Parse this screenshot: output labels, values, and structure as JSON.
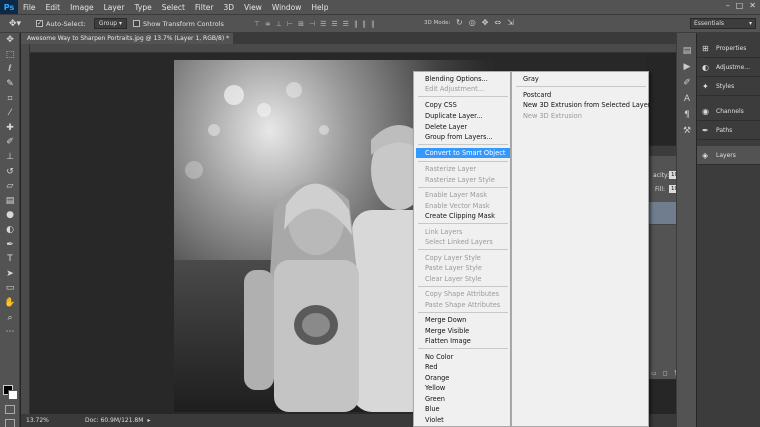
{
  "app": {
    "logo": "Ps"
  },
  "menubar": {
    "items": [
      "File",
      "Edit",
      "Image",
      "Layer",
      "Type",
      "Select",
      "Filter",
      "3D",
      "View",
      "Window",
      "Help"
    ],
    "window_controls": [
      "–",
      "□",
      "✕"
    ]
  },
  "options_bar": {
    "auto_select_label": "Auto-Select:",
    "auto_select_checked": true,
    "auto_select_target": "Group",
    "show_transform_label": "Show Transform Controls",
    "show_transform_checked": false,
    "mode_3d_label": "3D Mode:",
    "workspace": "Essentials"
  },
  "document": {
    "tab_title": "Awesome Way to Sharpen Portraits.jpg @ 13.7% (Layer 1, RGB/8) *",
    "zoom": "13.72%",
    "doc_info": "Doc: 60.9M/121.8M"
  },
  "right_panels": {
    "items": [
      {
        "label": "Properties",
        "icon": "properties-icon"
      },
      {
        "label": "Adjustme...",
        "icon": "adjustments-icon"
      },
      {
        "label": "Styles",
        "icon": "styles-icon"
      },
      {
        "label": "Channels",
        "icon": "channels-icon"
      },
      {
        "label": "Paths",
        "icon": "paths-icon"
      },
      {
        "label": "Layers",
        "icon": "layers-icon"
      }
    ]
  },
  "layers_panel": {
    "opacity_label": "acity:",
    "opacity_value": "100%",
    "fill_label": "Fill:",
    "fill_value": "100%"
  },
  "context_menu": {
    "items": [
      {
        "label": "Blending Options...",
        "disabled": false
      },
      {
        "label": "Edit Adjustment...",
        "disabled": true
      },
      {
        "label": "Copy CSS",
        "disabled": false
      },
      {
        "label": "Duplicate Layer...",
        "disabled": false
      },
      {
        "label": "Delete Layer",
        "disabled": false
      },
      {
        "label": "Group from Layers...",
        "disabled": false
      },
      {
        "label": "Convert to Smart Object",
        "disabled": false,
        "highlighted": true
      },
      {
        "label": "Rasterize Layer",
        "disabled": true
      },
      {
        "label": "Rasterize Layer Style",
        "disabled": true
      },
      {
        "label": "Enable Layer Mask",
        "disabled": true
      },
      {
        "label": "Enable Vector Mask",
        "disabled": true
      },
      {
        "label": "Create Clipping Mask",
        "disabled": false
      },
      {
        "label": "Link Layers",
        "disabled": true
      },
      {
        "label": "Select Linked Layers",
        "disabled": true
      },
      {
        "label": "Copy Layer Style",
        "disabled": true
      },
      {
        "label": "Paste Layer Style",
        "disabled": true
      },
      {
        "label": "Clear Layer Style",
        "disabled": true
      },
      {
        "label": "Copy Shape Attributes",
        "disabled": true
      },
      {
        "label": "Paste Shape Attributes",
        "disabled": true
      },
      {
        "label": "Merge Down",
        "disabled": false
      },
      {
        "label": "Merge Visible",
        "disabled": false
      },
      {
        "label": "Flatten Image",
        "disabled": false
      },
      {
        "label": "No Color",
        "disabled": false
      },
      {
        "label": "Red",
        "disabled": false
      },
      {
        "label": "Orange",
        "disabled": false
      },
      {
        "label": "Yellow",
        "disabled": false
      },
      {
        "label": "Green",
        "disabled": false
      },
      {
        "label": "Blue",
        "disabled": false
      },
      {
        "label": "Violet",
        "disabled": false
      }
    ]
  },
  "submenu": {
    "items": [
      {
        "label": "Gray",
        "disabled": false
      },
      {
        "label": "Postcard",
        "disabled": false
      },
      {
        "label": "New 3D Extrusion from Selected Layer",
        "disabled": false
      },
      {
        "label": "New 3D Extrusion",
        "disabled": true
      }
    ]
  },
  "colors": {
    "menu_highlight": "#3399ff",
    "ui_gray": "#535353",
    "ps_blue": "#31a8ff"
  }
}
